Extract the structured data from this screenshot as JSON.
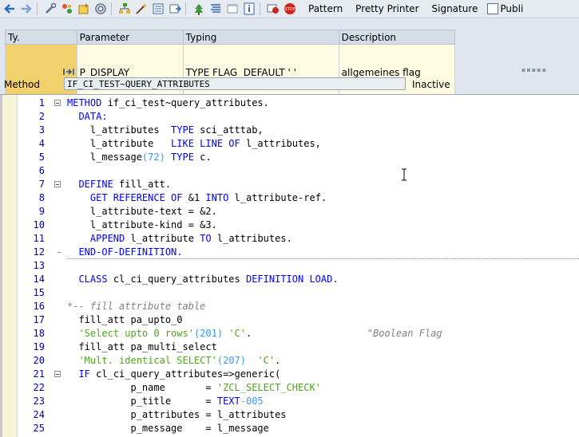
{
  "toolbar": {
    "icons": [
      "back-arrow-icon",
      "forward-arrow-icon",
      "tools-icon",
      "objects-icon",
      "activate-icon",
      "where-used-icon",
      "hierarchy-icon",
      "wizard-icon",
      "display-object-list-icon",
      "navigation-window-icon",
      "tree-icon",
      "list-icon",
      "window-icon",
      "info-icon",
      "stop-icon",
      "stop-all-icon"
    ],
    "pattern_label": "Pattern",
    "pretty_printer_label": "Pretty Printer",
    "signature_label": "Signature",
    "public_label": "Publi"
  },
  "params": {
    "columns": [
      "Ty.",
      "Parameter",
      "Typing",
      "Description"
    ],
    "rows": [
      {
        "type_icon": "importing-icon",
        "parameter": "P_DISPLAY",
        "typing": "TYPE FLAG  DEFAULT ' '",
        "description": "allgemeines flag"
      }
    ]
  },
  "method": {
    "label": "Method",
    "value": "IF_CI_TEST~QUERY_ATTRIBUTES",
    "status": "Inactive"
  },
  "code": {
    "lines": [
      {
        "n": "1",
        "fold": "open",
        "tokens": [
          [
            "kw",
            "METHOD "
          ],
          [
            "t",
            "if_ci_test~query_attributes."
          ]
        ]
      },
      {
        "n": "2",
        "tokens": [
          [
            "t",
            "  "
          ],
          [
            "kw",
            "DATA:"
          ]
        ]
      },
      {
        "n": "3",
        "tokens": [
          [
            "t",
            "    l_attributes  "
          ],
          [
            "kw",
            "TYPE "
          ],
          [
            "t",
            "sci_atttab,"
          ]
        ]
      },
      {
        "n": "4",
        "tokens": [
          [
            "t",
            "    l_attribute   "
          ],
          [
            "kw",
            "LIKE LINE OF "
          ],
          [
            "t",
            "l_attributes,"
          ]
        ]
      },
      {
        "n": "5",
        "tokens": [
          [
            "t",
            "    l_message"
          ],
          [
            "num",
            "(72) "
          ],
          [
            "kw",
            "TYPE "
          ],
          [
            "t",
            "c."
          ]
        ]
      },
      {
        "n": "6",
        "tokens": []
      },
      {
        "n": "7",
        "fold": "open",
        "tokens": [
          [
            "t",
            "  "
          ],
          [
            "kw",
            "DEFINE "
          ],
          [
            "t",
            "fill_att."
          ]
        ]
      },
      {
        "n": "8",
        "tokens": [
          [
            "t",
            "    "
          ],
          [
            "kw",
            "GET REFERENCE OF "
          ],
          [
            "t",
            "&1 "
          ],
          [
            "kw",
            "INTO "
          ],
          [
            "t",
            "l_attribute-ref."
          ]
        ]
      },
      {
        "n": "9",
        "tokens": [
          [
            "t",
            "    l_attribute-text = &2."
          ]
        ]
      },
      {
        "n": "10",
        "tokens": [
          [
            "t",
            "    l_attribute-kind = &3."
          ]
        ]
      },
      {
        "n": "11",
        "tokens": [
          [
            "t",
            "    "
          ],
          [
            "kw",
            "APPEND "
          ],
          [
            "t",
            "l_attribute "
          ],
          [
            "kw",
            "TO "
          ],
          [
            "t",
            "l_attributes."
          ]
        ]
      },
      {
        "n": "12",
        "fold": "end",
        "dots": true,
        "tokens": [
          [
            "t",
            "  "
          ],
          [
            "kw",
            "END-OF-DEFINITION."
          ]
        ]
      },
      {
        "n": "13",
        "tokens": []
      },
      {
        "n": "14",
        "tokens": [
          [
            "t",
            "  "
          ],
          [
            "kw",
            "CLASS "
          ],
          [
            "t",
            "cl_ci_query_attributes "
          ],
          [
            "kw",
            "DEFINITION LOAD."
          ]
        ]
      },
      {
        "n": "15",
        "tokens": []
      },
      {
        "n": "16",
        "tokens": [
          [
            "cmt",
            "*-- fill attribute table"
          ]
        ]
      },
      {
        "n": "17",
        "tokens": [
          [
            "t",
            "  fill_att pa_upto_0"
          ]
        ]
      },
      {
        "n": "18",
        "tokens": [
          [
            "t",
            "  "
          ],
          [
            "str",
            "'Select upto 0 rows'"
          ],
          [
            "num",
            "(201) "
          ],
          [
            "str",
            "'C'"
          ],
          [
            "t",
            ".                    "
          ],
          [
            "cmt",
            "\"Boolean Flag"
          ]
        ]
      },
      {
        "n": "19",
        "tokens": [
          [
            "t",
            "  fill_att pa_multi_select"
          ]
        ]
      },
      {
        "n": "20",
        "tokens": [
          [
            "t",
            "  "
          ],
          [
            "str",
            "'Mult. identical SELECT'"
          ],
          [
            "num",
            "(207)  "
          ],
          [
            "str",
            "'C'"
          ],
          [
            "t",
            "."
          ]
        ]
      },
      {
        "n": "21",
        "fold": "open",
        "tokens": [
          [
            "t",
            "  "
          ],
          [
            "kw",
            "IF "
          ],
          [
            "t",
            "cl_ci_query_attributes=>generic("
          ]
        ]
      },
      {
        "n": "22",
        "tokens": [
          [
            "t",
            "           p_name       = "
          ],
          [
            "str",
            "'ZCL_SELECT_CHECK'"
          ]
        ]
      },
      {
        "n": "23",
        "tokens": [
          [
            "t",
            "           p_title      = "
          ],
          [
            "kw",
            "TEXT"
          ],
          [
            "num",
            "-005"
          ]
        ]
      },
      {
        "n": "24",
        "tokens": [
          [
            "t",
            "           p_attributes = l_attributes"
          ]
        ]
      },
      {
        "n": "25",
        "tokens": [
          [
            "t",
            "           p_message    = l_message"
          ]
        ]
      }
    ]
  }
}
